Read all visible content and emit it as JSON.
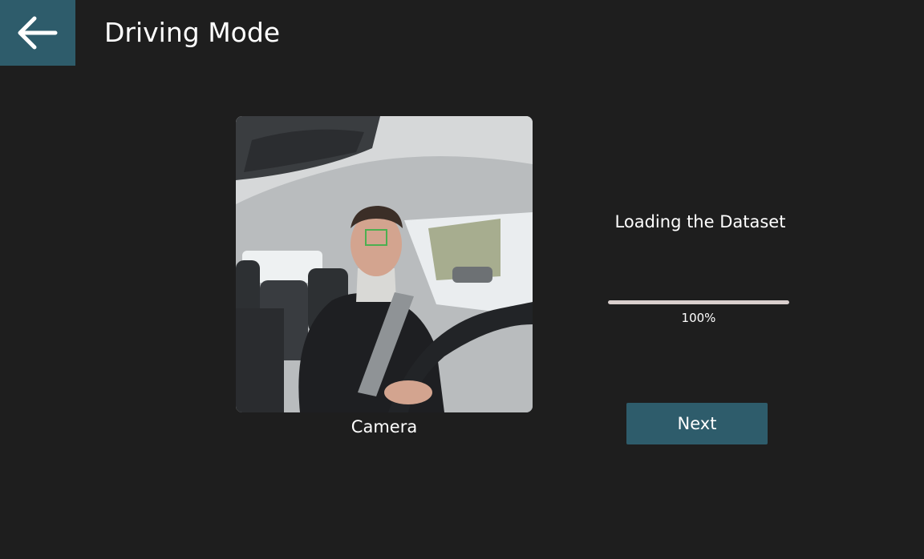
{
  "header": {
    "title": "Driving Mode",
    "back_icon": "arrow-left-icon"
  },
  "camera": {
    "label": "Camera",
    "detection_box_color": "#4caf50"
  },
  "loading": {
    "status": "Loading the Dataset",
    "progress_value": 1.0,
    "progress_text": "100%"
  },
  "actions": {
    "next_label": "Next"
  },
  "colors": {
    "background": "#1e1e1e",
    "accent": "#2e5c6b",
    "progress": "#d9cfcd"
  }
}
